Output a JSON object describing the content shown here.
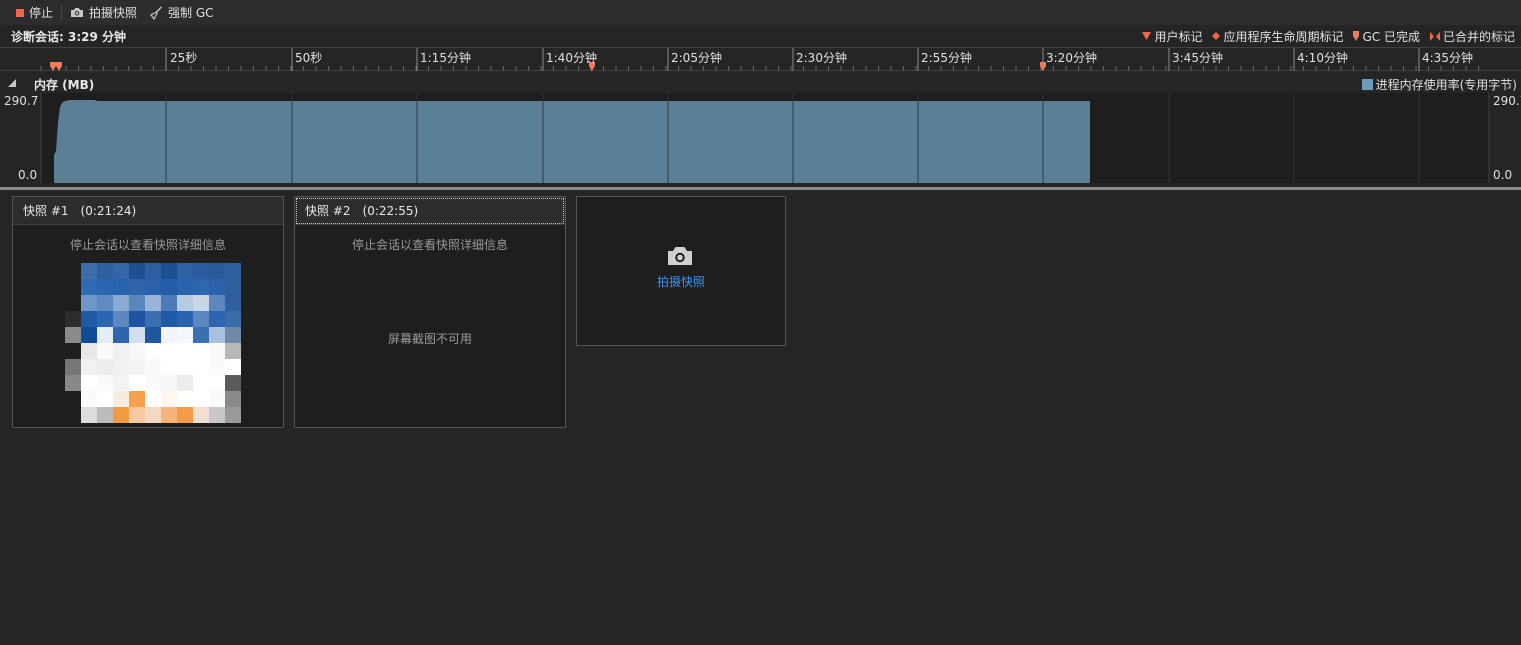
{
  "toolbar": {
    "stop_label": "停止",
    "snapshot_label": "拍摄快照",
    "gc_label": "强制 GC"
  },
  "session": {
    "label": "诊断会话: 3:29 分钟"
  },
  "legend": {
    "user_mark": "用户标记",
    "lifecycle_mark": "应用程序生命周期标记",
    "gc_done": "GC 已完成",
    "merged_mark": "已合并的标记"
  },
  "ruler": {
    "ticks": [
      "25秒",
      "50秒",
      "1:15分钟",
      "1:40分钟",
      "2:05分钟",
      "2:30分钟",
      "2:55分钟",
      "3:20分钟",
      "3:45分钟",
      "4:10分钟",
      "4:35分钟"
    ]
  },
  "memory": {
    "title": "内存 (MB)",
    "legend_label": "进程内存使用率(专用字节)",
    "y_max": "290.7",
    "y_min": "0.0",
    "y_max_right": "290.7",
    "y_min_right": "0.0"
  },
  "colors": {
    "series": "#5b7f95",
    "accent": "#3794ff",
    "marker": "#f07a5a"
  },
  "snapshots": [
    {
      "title": "快照 #1",
      "time": "(0:21:24)",
      "message": "停止会话以查看快照详细信息"
    },
    {
      "title": "快照 #2",
      "time": "(0:22:55)",
      "message": "停止会话以查看快照详细信息",
      "unavailable": "屏幕截图不可用"
    }
  ],
  "take_snapshot": {
    "label": "拍摄快照"
  }
}
